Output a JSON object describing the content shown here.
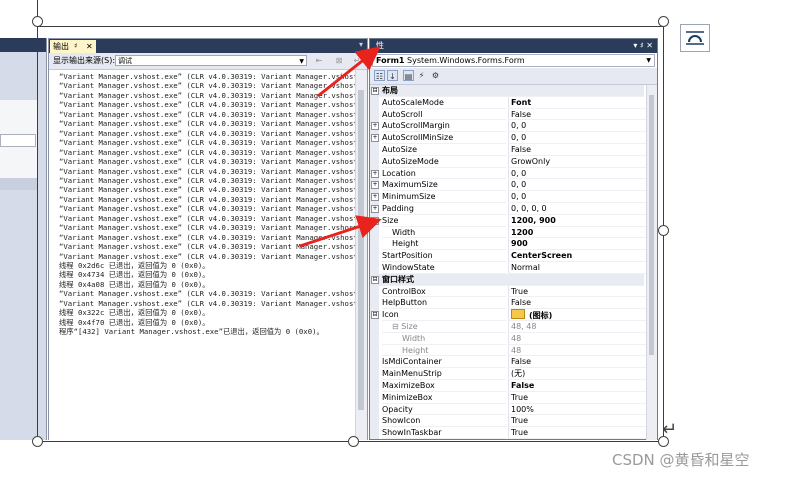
{
  "output": {
    "tab_label": "输出",
    "tab_pin": "♯",
    "tab_close": "✕",
    "source_label": "显示输出来源(S):",
    "source_value": "调试",
    "lines": [
      "“Variant Manager.vshost.exe” (CLR v4.0.30319: Variant Manager.vshost.exe",
      "“Variant Manager.vshost.exe” (CLR v4.0.30319: Variant Manager.vshost.exe",
      "“Variant Manager.vshost.exe” (CLR v4.0.30319: Variant Manager.vshost.exe",
      "“Variant Manager.vshost.exe” (CLR v4.0.30319: Variant Manager.vshost.exe",
      "“Variant Manager.vshost.exe” (CLR v4.0.30319: Variant Manager.vshost.exe",
      "“Variant Manager.vshost.exe” (CLR v4.0.30319: Variant Manager.vshost.exe",
      "“Variant Manager.vshost.exe” (CLR v4.0.30319: Variant Manager.vshost.exe",
      "“Variant Manager.vshost.exe” (CLR v4.0.30319: Variant Manager.vshost.exe",
      "“Variant Manager.vshost.exe” (CLR v4.0.30319: Variant Manager.vshost.exe",
      "“Variant Manager.vshost.exe” (CLR v4.0.30319: Variant Manager.vshost.exe",
      "“Variant Manager.vshost.exe” (CLR v4.0.30319: Variant Manager.vshost.exe",
      "“Variant Manager.vshost.exe” (CLR v4.0.30319: Variant Manager.vshost.exe",
      "“Variant Manager.vshost.exe” (CLR v4.0.30319: Variant Manager.vshost.exe",
      "“Variant Manager.vshost.exe” (CLR v4.0.30319: Variant Manager.vshost.exe",
      "“Variant Manager.vshost.exe” (CLR v4.0.30319: Variant Manager.vshost.exe",
      "“Variant Manager.vshost.exe” (CLR v4.0.30319: Variant Manager.vshost.exe",
      "“Variant Manager.vshost.exe” (CLR v4.0.30319: Variant Manager.vshost.exe",
      "“Variant Manager.vshost.exe” (CLR v4.0.30319: Variant Manager.vshost.exe",
      "“Variant Manager.vshost.exe” (CLR v4.0.30319: Variant Manager.vshost.exe",
      "“Variant Manager.vshost.exe” (CLR v4.0.30319: Variant Manager.vshost.exe",
      "线程 0x2d6c 已退出，返回值为 0 (0x0)。",
      "线程 0x4734 已退出，返回值为 0 (0x0)。",
      "线程 0x4a08 已退出，返回值为 0 (0x0)。",
      "“Variant Manager.vshost.exe” (CLR v4.0.30319: Variant Manager.vshost.exe",
      "“Variant Manager.vshost.exe” (CLR v4.0.30319: Variant Manager.vshost.exe",
      "线程 0x322c 已退出，返回值为 0 (0x0)。",
      "线程 0x4f70 已退出，返回值为 0 (0x0)。",
      "程序“[432] Variant Manager.vshost.exe”已退出，返回值为 0 (0x0)。"
    ]
  },
  "properties": {
    "title": "性",
    "title_pin": "▾ ♯ ✕",
    "object_name": "Form1",
    "object_type": "System.Windows.Forms.Form",
    "rows": [
      {
        "kind": "cat",
        "expander": "⊟",
        "name": "布局",
        "value": ""
      },
      {
        "kind": "prop",
        "expander": "",
        "name": "AutoScaleMode",
        "value": "Font",
        "bold": true
      },
      {
        "kind": "prop",
        "expander": "",
        "name": "AutoScroll",
        "value": "False",
        "bold": false
      },
      {
        "kind": "prop",
        "expander": "+",
        "name": "AutoScrollMargin",
        "value": "0, 0",
        "bold": false
      },
      {
        "kind": "prop",
        "expander": "+",
        "name": "AutoScrollMinSize",
        "value": "0, 0",
        "bold": false
      },
      {
        "kind": "prop",
        "expander": "",
        "name": "AutoSize",
        "value": "False",
        "bold": false
      },
      {
        "kind": "prop",
        "expander": "",
        "name": "AutoSizeMode",
        "value": "GrowOnly",
        "bold": false
      },
      {
        "kind": "prop",
        "expander": "+",
        "name": "Location",
        "value": "0, 0",
        "bold": false
      },
      {
        "kind": "prop",
        "expander": "+",
        "name": "MaximumSize",
        "value": "0, 0",
        "bold": false
      },
      {
        "kind": "prop",
        "expander": "+",
        "name": "MinimumSize",
        "value": "0, 0",
        "bold": false
      },
      {
        "kind": "prop",
        "expander": "+",
        "name": "Padding",
        "value": "0, 0, 0, 0",
        "bold": false
      },
      {
        "kind": "prop",
        "expander": "−",
        "name": "Size",
        "value": "1200, 900",
        "bold": true
      },
      {
        "kind": "sub",
        "expander": "",
        "name": "Width",
        "value": "1200",
        "bold": true
      },
      {
        "kind": "sub",
        "expander": "",
        "name": "Height",
        "value": "900",
        "bold": true
      },
      {
        "kind": "prop",
        "expander": "",
        "name": "StartPosition",
        "value": "CenterScreen",
        "bold": true
      },
      {
        "kind": "prop",
        "expander": "",
        "name": "WindowState",
        "value": "Normal",
        "bold": false
      },
      {
        "kind": "cat",
        "expander": "⊟",
        "name": "窗口样式",
        "value": ""
      },
      {
        "kind": "prop",
        "expander": "",
        "name": "ControlBox",
        "value": "True",
        "bold": false
      },
      {
        "kind": "prop",
        "expander": "",
        "name": "HelpButton",
        "value": "False",
        "bold": false
      },
      {
        "kind": "icon",
        "expander": "⊟",
        "name": "Icon",
        "value": "(图标)",
        "bold": true
      },
      {
        "kind": "sub-dim",
        "expander": "",
        "name": "⊟ Size",
        "value": "48, 48",
        "bold": false
      },
      {
        "kind": "sub2",
        "expander": "",
        "name": "Width",
        "value": "48",
        "bold": false
      },
      {
        "kind": "sub2",
        "expander": "",
        "name": "Height",
        "value": "48",
        "bold": false
      },
      {
        "kind": "prop",
        "expander": "",
        "name": "IsMdiContainer",
        "value": "False",
        "bold": false
      },
      {
        "kind": "prop",
        "expander": "",
        "name": "MainMenuStrip",
        "value": "(无)",
        "bold": false
      },
      {
        "kind": "prop",
        "expander": "",
        "name": "MaximizeBox",
        "value": "False",
        "bold": true
      },
      {
        "kind": "prop",
        "expander": "",
        "name": "MinimizeBox",
        "value": "True",
        "bold": false
      },
      {
        "kind": "prop",
        "expander": "",
        "name": "Opacity",
        "value": "100%",
        "bold": false
      },
      {
        "kind": "prop",
        "expander": "",
        "name": "ShowIcon",
        "value": "True",
        "bold": false
      },
      {
        "kind": "prop",
        "expander": "",
        "name": "ShowInTaskbar",
        "value": "True",
        "bold": false
      }
    ]
  },
  "watermark": "CSDN @黄昏和星空",
  "colors": {
    "title_bar": "#2b3c5a",
    "tab_active": "#fff5c8",
    "arrow": "#e8231d",
    "icon_folder": "#f5c74a"
  },
  "icons": [
    "categorized-icon",
    "alphabetical-icon",
    "properties-icon",
    "events-icon",
    "property-pages-icon",
    "layout-options-icon"
  ]
}
